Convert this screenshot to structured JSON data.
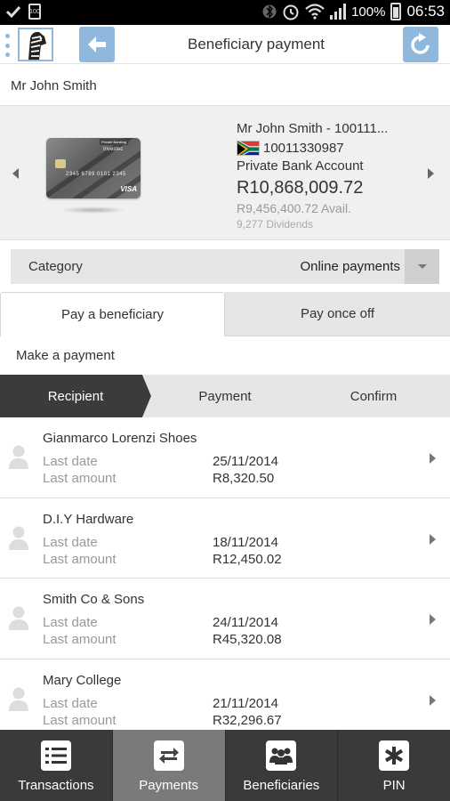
{
  "status_bar": {
    "battery_percent": "100%",
    "time": "06:53"
  },
  "header": {
    "title": "Beneficiary payment"
  },
  "user": {
    "name": "Mr John Smith"
  },
  "account": {
    "name": "Mr John Smith - 100111...",
    "number": "10011330987",
    "type": "Private Bank Account",
    "balance": "R10,868,009.72",
    "available": "R9,456,400.72 Avail.",
    "dividends": "9,277 Dividends",
    "card": {
      "bank_badge": "Private Banking",
      "brand": "Investec",
      "number": "2345 6789 0101 2345",
      "network": "VISA"
    }
  },
  "category": {
    "label": "Category",
    "value": "Online payments"
  },
  "tabs": [
    {
      "label": "Pay a beneficiary",
      "active": true
    },
    {
      "label": "Pay once off",
      "active": false
    }
  ],
  "section_title": "Make a payment",
  "steps": [
    {
      "label": "Recipient",
      "active": true
    },
    {
      "label": "Payment",
      "active": false
    },
    {
      "label": "Confirm",
      "active": false
    }
  ],
  "recipients": [
    {
      "name": "Gianmarco Lorenzi Shoes",
      "last_date_label": "Last date",
      "last_date": "25/11/2014",
      "last_amount_label": "Last amount",
      "last_amount": "R8,320.50"
    },
    {
      "name": "D.I.Y Hardware",
      "last_date_label": "Last date",
      "last_date": "18/11/2014",
      "last_amount_label": "Last amount",
      "last_amount": "R12,450.02"
    },
    {
      "name": "Smith Co & Sons",
      "last_date_label": "Last date",
      "last_date": "24/11/2014",
      "last_amount_label": "Last amount",
      "last_amount": "R45,320.08"
    },
    {
      "name": "Mary College",
      "last_date_label": "Last date",
      "last_date": "21/11/2014",
      "last_amount_label": "Last amount",
      "last_amount": "R32,296.67"
    }
  ],
  "bottom_nav": [
    {
      "label": "Transactions",
      "icon": "list-icon",
      "active": false
    },
    {
      "label": "Payments",
      "icon": "transfer-arrows-icon",
      "active": true
    },
    {
      "label": "Beneficiaries",
      "icon": "people-icon",
      "active": false
    },
    {
      "label": "PIN",
      "icon": "asterisk-icon",
      "active": false
    }
  ],
  "colors": {
    "accent": "#8fb8dc",
    "nav_bg": "#3a3a3a",
    "nav_active": "#7a7a7a",
    "step_active": "#3b3b3b"
  }
}
